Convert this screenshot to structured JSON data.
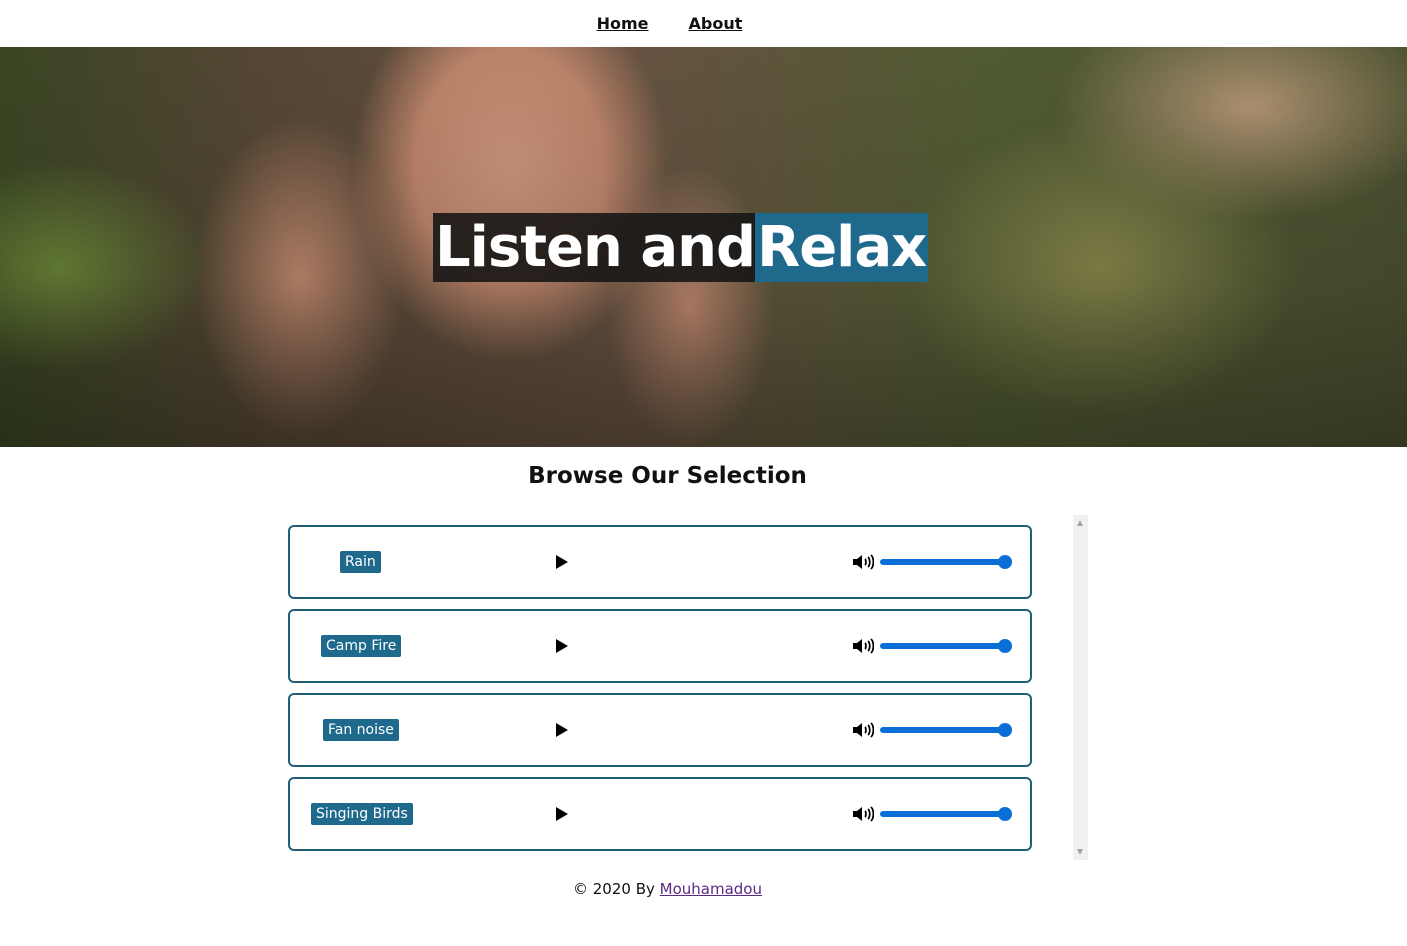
{
  "nav": {
    "items": [
      {
        "label": "Home"
      },
      {
        "label": "About"
      }
    ]
  },
  "hero": {
    "title_part1": "Listen and ",
    "title_part2": "Relax"
  },
  "section": {
    "title": "Browse Our Selection"
  },
  "sounds": [
    {
      "label": "Rain",
      "volume": 1.0
    },
    {
      "label": "Camp Fire",
      "volume": 1.0
    },
    {
      "label": "Fan noise",
      "volume": 1.0
    },
    {
      "label": "Singing Birds",
      "volume": 1.0
    }
  ],
  "footer": {
    "text": "© 2020 By ",
    "author": "Mouhamadou"
  },
  "colors": {
    "accent": "#1f6a8c",
    "slider": "#0b6fd8",
    "link_visited": "#5b2a86"
  },
  "icons": {
    "play": "play-icon",
    "volume": "volume-icon"
  }
}
